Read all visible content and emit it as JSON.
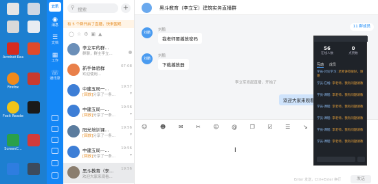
{
  "desktop": {
    "icons": [
      "",
      "",
      "Acrobat Reader DC",
      "",
      "Firefox",
      "",
      "Foxit Reader",
      "",
      "ScreenC...",
      ""
    ]
  },
  "rail": {
    "avatar_text": "云讯",
    "nav": [
      {
        "label": "消息",
        "glyph": "◉"
      },
      {
        "label": "文档",
        "glyph": "☰"
      },
      {
        "label": "工作",
        "glyph": "▦"
      },
      {
        "label": "通讯录",
        "glyph": "☏"
      }
    ]
  },
  "conversation_list": {
    "search_placeholder": "搜索",
    "add_label": "+",
    "notice": "有 5 个群开启了直播，快来围观",
    "items": [
      {
        "name": "李立军的群...",
        "time": "",
        "preview": "群聊，群主李立...",
        "tag": ""
      },
      {
        "name": "新手体验群",
        "time": "07-08",
        "preview": "欢迎使用...",
        "tag": ""
      },
      {
        "name": "中建五局一...",
        "time": "19:57",
        "preview": "分享了一条...",
        "tag": "[回放]"
      },
      {
        "name": "中建五局—...",
        "time": "19:56",
        "preview": "分享了一条...",
        "tag": "[回放]"
      },
      {
        "name": "阳光培训课...",
        "time": "19:56",
        "preview": "分享了一条...",
        "tag": "[回放]"
      },
      {
        "name": "中建五局—...",
        "time": "19:56",
        "preview": "分享了一条...",
        "tag": "[回放]"
      },
      {
        "name": "黑斗教育（李...",
        "time": "19:56",
        "preview": "欢迎大家来观看...",
        "tag": ""
      }
    ]
  },
  "chat": {
    "title": "黑斗教育（李立军）建筑实务直播群",
    "members": "11 群成员",
    "messages": [
      {
        "sender": "刘鹏",
        "avatar": "刘鹏",
        "text": "我老师要播放密码"
      },
      {
        "sender": "刘鹏",
        "avatar": "刘鹏",
        "text": "下载播放器"
      }
    ],
    "system": "李立军发起直播，开始了",
    "my_message": "欢迎大家来观看...",
    "input_icons": "☺ ☻ ✉ ✂ ☺ @ ❐ ☑ ☰ ↘ ❐",
    "send_hint": "Enter 发送，Ctrl+Enter 换行",
    "send_label": "发送"
  },
  "live_panel": {
    "stats": [
      {
        "value": "56",
        "label": "在线人数"
      },
      {
        "value": "0",
        "label": "点赞数"
      }
    ],
    "tabs": [
      "互动",
      "成员"
    ],
    "comments": [
      {
        "user": "学员·讨论学习:",
        "text": "老师讲得很好，谢谢"
      },
      {
        "user": "学员·在线:",
        "text": "李老师，我有问题请教"
      },
      {
        "user": "学员·课程:",
        "text": "李老师，我有问题请教"
      },
      {
        "user": "学员·课程:",
        "text": "李老师，我有问题请教"
      },
      {
        "user": "学员·课程:",
        "text": "李老师，我有问题请教"
      },
      {
        "user": "学员·课程:",
        "text": "李老师，我有问题请教"
      },
      {
        "user": "学员·课程:",
        "text": "李老师，我有问题请教"
      }
    ]
  },
  "colors": {
    "rail": "#1487f6",
    "desktop": "#1d7fd0",
    "accent": "#e58a1f"
  }
}
